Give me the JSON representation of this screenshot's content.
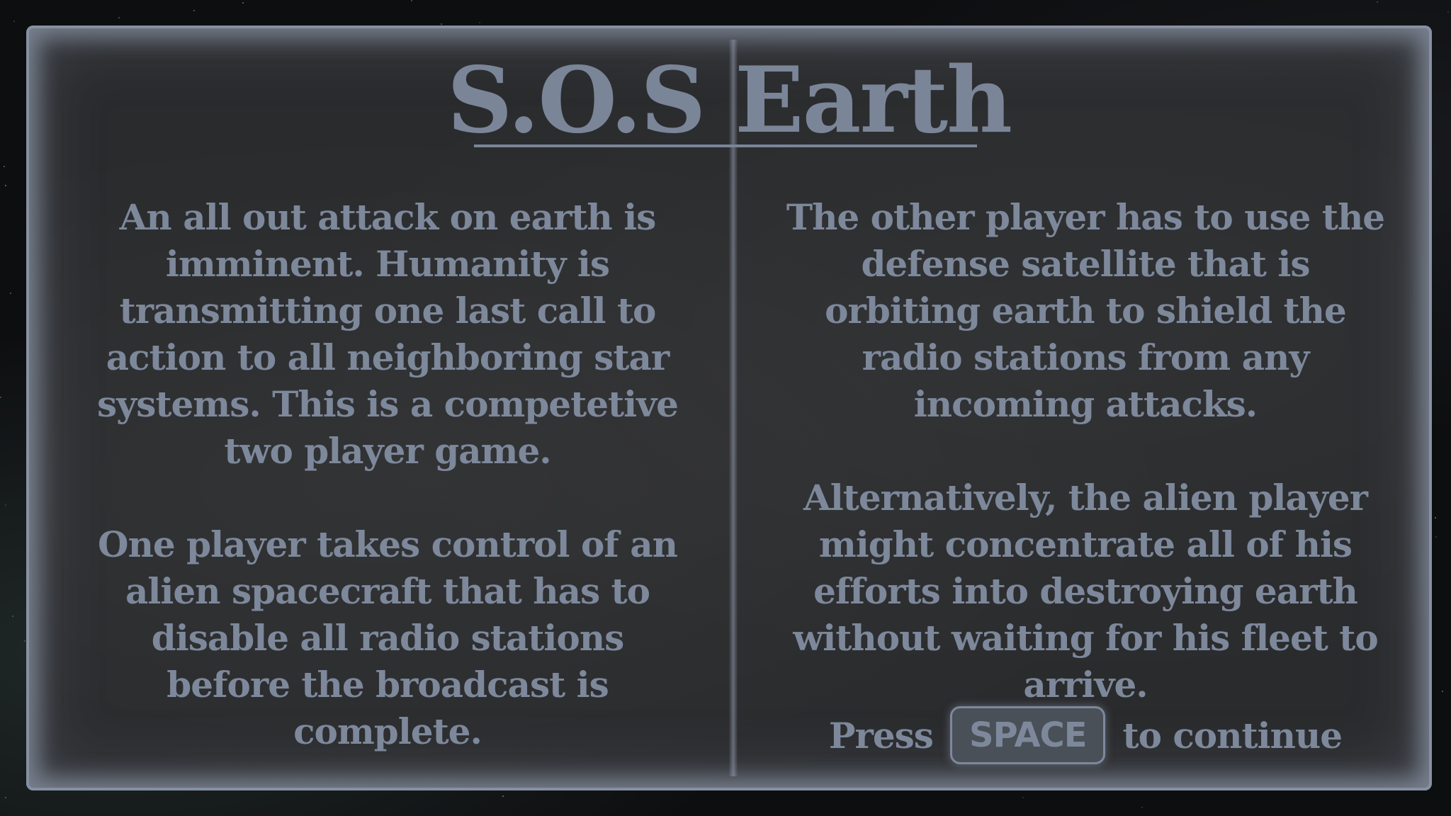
{
  "title": "S.O.S Earth",
  "left_column": {
    "paragraph1": "An all out attack on earth is\nimminent. Humanity is\ntransmitting one last call to\naction to all neighboring star\nsystems. This is a competetive\ntwo player game.",
    "paragraph2": "One player takes control of an\nalien spacecraft that has to\ndisable all radio stations\nbefore the broadcast is\ncomplete."
  },
  "right_column": {
    "paragraph1": "The other player has to use the\ndefense satellite that is\norbiting earth to shield the\nradio stations from any\nincoming attacks.",
    "paragraph2": "Alternatively, the alien player\nmight concentrate all of his\nefforts into destroying earth\nwithout waiting for his fleet to\narrive."
  },
  "prompt": {
    "prefix": "Press",
    "key": "SPACE",
    "suffix": "to continue"
  },
  "colors": {
    "text": "#7d889b",
    "panel": "#2a2b2d",
    "border": "#8590a2",
    "background": "#0d0e10"
  }
}
